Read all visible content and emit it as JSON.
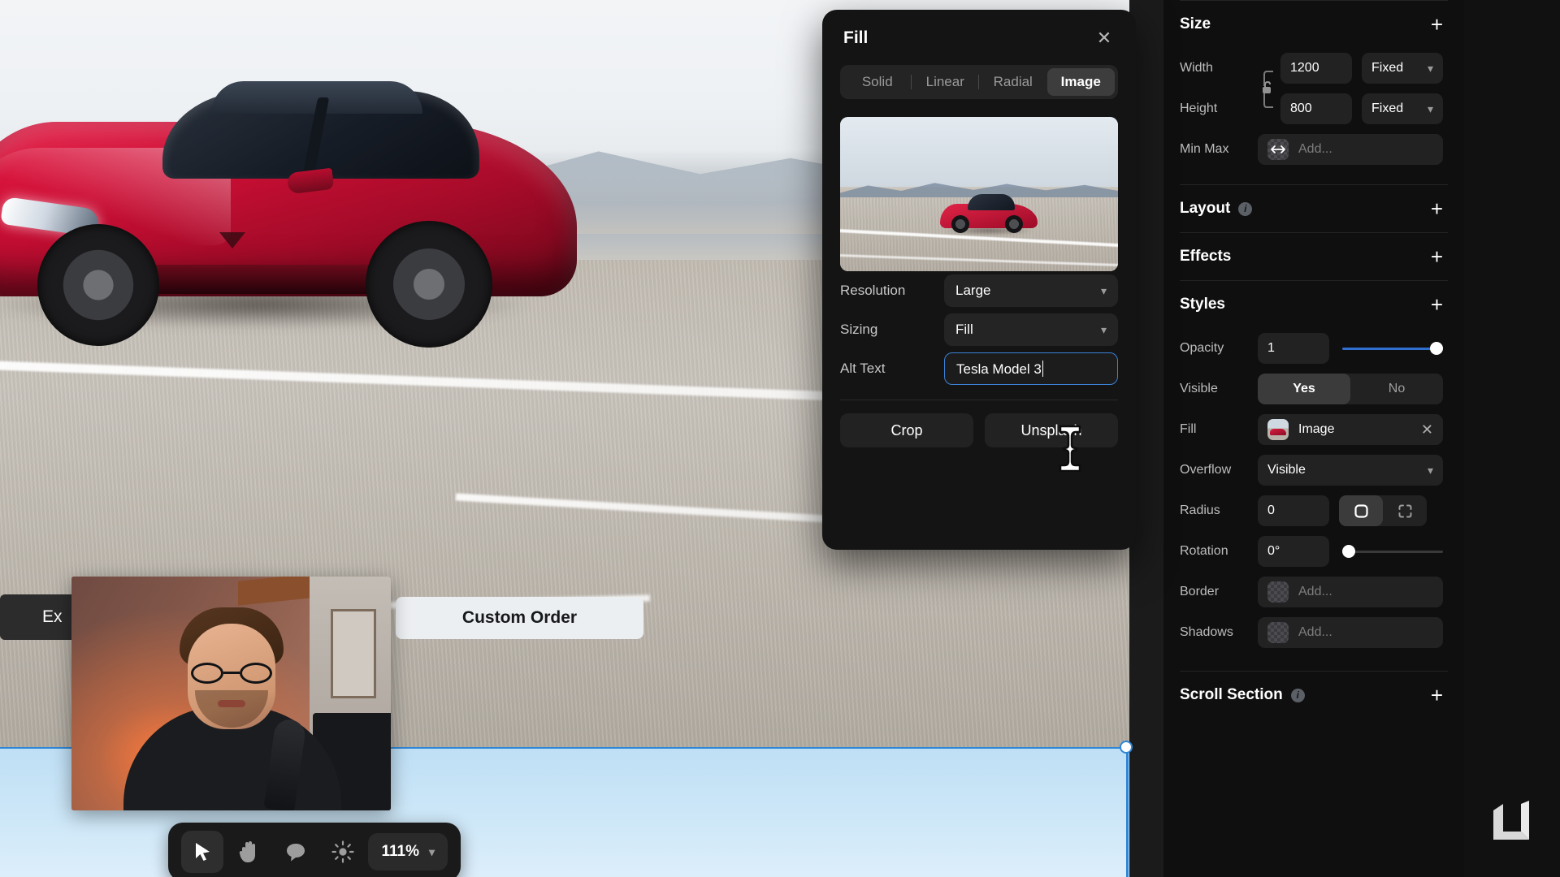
{
  "canvas": {
    "hero_alt": "Red Tesla Model 3 driving on desert highway",
    "cta_dark_label": "Ex",
    "cta_light_label": "Custom Order",
    "webcam_alt": "Presenter webcam overlay"
  },
  "fill_panel": {
    "title": "Fill",
    "close_icon": "close-icon",
    "tabs": [
      {
        "label": "Solid",
        "active": false
      },
      {
        "label": "Linear",
        "active": false
      },
      {
        "label": "Radial",
        "active": false
      },
      {
        "label": "Image",
        "active": true
      }
    ],
    "preview_alt": "Red Tesla Model 3 on desert road",
    "fields": [
      {
        "label": "Resolution",
        "value": "Large",
        "type": "select"
      },
      {
        "label": "Sizing",
        "value": "Fill",
        "type": "select"
      },
      {
        "label": "Alt Text",
        "value": "Tesla Model 3",
        "type": "text",
        "focused": true
      }
    ],
    "actions": [
      {
        "label": "Crop"
      },
      {
        "label": "Unsplash"
      }
    ]
  },
  "sidebar": {
    "sections": [
      {
        "title": "Size",
        "add_label": "+",
        "rows": [
          {
            "label": "Width",
            "value": "1200",
            "unit": "Fixed"
          },
          {
            "label": "Height",
            "value": "800",
            "unit": "Fixed"
          },
          {
            "label": "Min Max",
            "placeholder": "Add..."
          }
        ]
      },
      {
        "title": "Layout",
        "has_info": true,
        "add_label": "+"
      },
      {
        "title": "Effects",
        "add_label": "+"
      },
      {
        "title": "Styles",
        "add_label": "+",
        "rows": [
          {
            "label": "Opacity",
            "value": "1",
            "slider": 100
          },
          {
            "label": "Visible",
            "toggle_yes": "Yes",
            "toggle_no": "No",
            "selected": "Yes"
          },
          {
            "label": "Fill",
            "value": "Image",
            "swatch": "image-thumbnail",
            "clear_icon": "close-icon"
          },
          {
            "label": "Overflow",
            "value": "Visible"
          },
          {
            "label": "Radius",
            "value": "0",
            "mode_all_icon": "rounded-square-icon",
            "mode_individual_icon": "corners-icon",
            "mode_selected": "all"
          },
          {
            "label": "Rotation",
            "value": "0°",
            "slider": 0
          },
          {
            "label": "Border",
            "placeholder": "Add..."
          },
          {
            "label": "Shadows",
            "placeholder": "Add..."
          }
        ]
      },
      {
        "title": "Scroll Section",
        "has_info": true,
        "add_label": "+"
      }
    ]
  },
  "toolbar": {
    "tools": [
      {
        "icon": "cursor-icon",
        "active": true
      },
      {
        "icon": "hand-icon",
        "active": false
      },
      {
        "icon": "comment-icon",
        "active": false
      },
      {
        "icon": "brightness-icon",
        "active": false
      }
    ],
    "zoom_level": "111%",
    "zoom_chevron": "chevron-down-icon"
  },
  "colors": {
    "accent": "#2f6fd0",
    "selection": "#2f86d6",
    "panel_bg": "#141414",
    "sidebar_bg": "#0f0f0f"
  }
}
